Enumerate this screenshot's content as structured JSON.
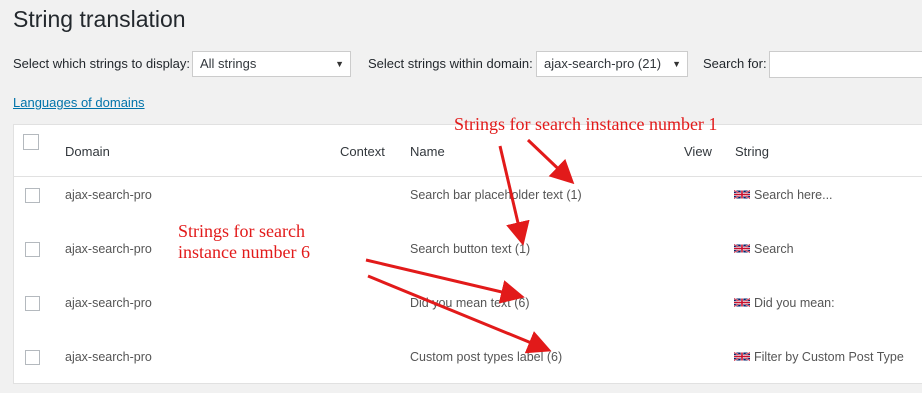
{
  "page": {
    "title": "String translation",
    "display_label": "Select which strings to display:",
    "display_value": "All strings",
    "domain_label": "Select strings within domain:",
    "domain_value": "ajax-search-pro (21)",
    "search_label": "Search for:",
    "search_value": "",
    "languages_link": "Languages of domains"
  },
  "table": {
    "columns": [
      "Domain",
      "Context",
      "Name",
      "View",
      "String"
    ],
    "rows": [
      {
        "domain": "ajax-search-pro",
        "context": "",
        "name": "Search bar placeholder text (1)",
        "view": "",
        "string": "Search here..."
      },
      {
        "domain": "ajax-search-pro",
        "context": "",
        "name": "Search button text (1)",
        "view": "",
        "string": "Search"
      },
      {
        "domain": "ajax-search-pro",
        "context": "",
        "name": "Did you mean text (6)",
        "view": "",
        "string": "Did you mean:"
      },
      {
        "domain": "ajax-search-pro",
        "context": "",
        "name": "Custom post types label (6)",
        "view": "",
        "string": "Filter by Custom Post Type"
      }
    ]
  },
  "annotations": {
    "note1": "Strings for search instance number 1",
    "note6_line1": "Strings for search",
    "note6_line2": "instance number 6"
  },
  "colors": {
    "annotation": "#e21a1a",
    "link": "#0073aa"
  },
  "icons": {
    "dropdown": "chevron-down-icon",
    "flag": "uk-flag-icon"
  }
}
